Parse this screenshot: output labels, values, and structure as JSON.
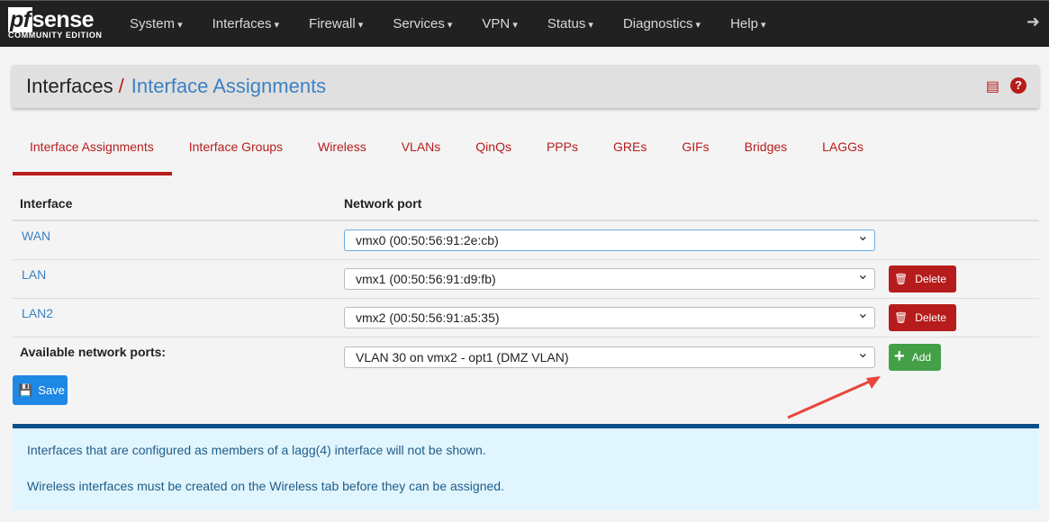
{
  "brand": {
    "name_pf": "pf",
    "name_sense": "sense",
    "edition": "COMMUNITY EDITION"
  },
  "nav": [
    "System",
    "Interfaces",
    "Firewall",
    "Services",
    "VPN",
    "Status",
    "Diagnostics",
    "Help"
  ],
  "breadcrumb": {
    "parent": "Interfaces",
    "separator": "/",
    "current": "Interface Assignments"
  },
  "tabs": [
    "Interface Assignments",
    "Interface Groups",
    "Wireless",
    "VLANs",
    "QinQs",
    "PPPs",
    "GREs",
    "GIFs",
    "Bridges",
    "LAGGs"
  ],
  "table": {
    "headers": [
      "Interface",
      "Network port"
    ],
    "rows": [
      {
        "name": "WAN",
        "port": "vmx0 (00:50:56:91:2e:cb)"
      },
      {
        "name": "LAN",
        "port": "vmx1 (00:50:56:91:d9:fb)",
        "action": "Delete"
      },
      {
        "name": "LAN2",
        "port": "vmx2 (00:50:56:91:a5:35)",
        "action": "Delete"
      }
    ],
    "available": {
      "label": "Available network ports:",
      "port": "VLAN 30 on vmx2 - opt1 (DMZ VLAN)",
      "action": "Add"
    }
  },
  "save_label": "Save",
  "info": [
    "Interfaces that are configured as members of a lagg(4) interface will not be shown.",
    "Wireless interfaces must be created on the Wireless tab before they can be assigned."
  ]
}
